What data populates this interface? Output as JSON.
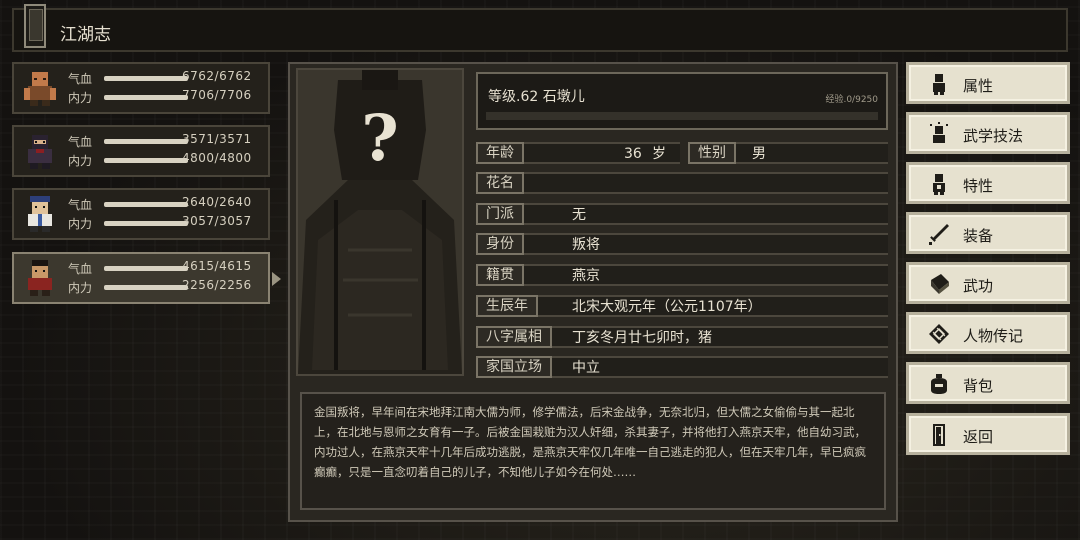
{
  "window": {
    "title": "江湖志"
  },
  "party": [
    {
      "hp_label": "气血",
      "hp": "6762/6762",
      "hp_fill": 1.0,
      "mp_label": "内力",
      "mp": "7706/7706",
      "mp_fill": 1.0,
      "selected": false
    },
    {
      "hp_label": "气血",
      "hp": "3571/3571",
      "hp_fill": 1.0,
      "mp_label": "内力",
      "mp": "4800/4800",
      "mp_fill": 1.0,
      "selected": false
    },
    {
      "hp_label": "气血",
      "hp": "2640/2640",
      "hp_fill": 1.0,
      "mp_label": "内力",
      "mp": "3057/3057",
      "mp_fill": 1.0,
      "selected": false
    },
    {
      "hp_label": "气血",
      "hp": "4615/4615",
      "hp_fill": 1.0,
      "mp_label": "内力",
      "mp": "2256/2256",
      "mp_fill": 1.0,
      "selected": true
    }
  ],
  "character": {
    "name_line": "等级.62 石墩儿",
    "exp": "经验.0/9250",
    "exp_fill": 0.0,
    "age_label": "年龄",
    "age_value": "36",
    "age_unit": "岁",
    "gender_label": "性别",
    "gender_value": "男",
    "fields": [
      {
        "label": "花名",
        "value": ""
      },
      {
        "label": "门派",
        "value": "无"
      },
      {
        "label": "身份",
        "value": "叛将"
      },
      {
        "label": "籍贯",
        "value": "燕京"
      },
      {
        "label": "生辰年",
        "value": "北宋大观元年（公元1107年）"
      },
      {
        "label": "八字属相",
        "value": "丁亥冬月廿七卯时，猪"
      },
      {
        "label": "家国立场",
        "value": "中立"
      }
    ],
    "description": "金国叛将，早年间在宋地拜江南大儒为师，修学儒法，后宋金战争，无奈北归，但大儒之女偷偷与其一起北上，在北地与恩师之女育有一子。后被金国栽赃为汉人奸细，杀其妻子，并将他打入燕京天牢，他自幼习武，内功过人，在燕京天牢十几年后成功逃脱，是燕京天牢仅几年唯一自己逃走的犯人，但在天牢几年，早已疯疯癫癫，只是一直念叨着自己的儿子，不知他儿子如今在何处……"
  },
  "menu": [
    {
      "label": "属性",
      "icon": "person-icon"
    },
    {
      "label": "武学技法",
      "icon": "skills-icon"
    },
    {
      "label": "特性",
      "icon": "traits-icon"
    },
    {
      "label": "装备",
      "icon": "sword-icon"
    },
    {
      "label": "武功",
      "icon": "book-icon"
    },
    {
      "label": "人物传记",
      "icon": "scroll-icon"
    },
    {
      "label": "背包",
      "icon": "bag-icon"
    },
    {
      "label": "返回",
      "icon": "door-icon"
    }
  ]
}
